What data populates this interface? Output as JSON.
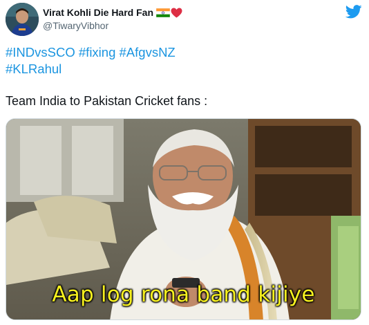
{
  "tweet": {
    "author": {
      "display_name": "Virat Kohli Die Hard Fan",
      "handle": "@TiwaryVibhor",
      "name_emojis": [
        "flag-india",
        "red-heart"
      ]
    },
    "hashtags": [
      "#INDvsSCO",
      "#fixing",
      "#AfgvsNZ",
      "#KLRahul"
    ],
    "text": "Team India to Pakistan Cricket fans :",
    "media": {
      "subtitle": "Aap log rona band kijiye"
    },
    "colors": {
      "link": "#1b95e0",
      "twitter_blue": "#1d9bf0",
      "subtitle_yellow": "#f6f01f"
    }
  }
}
